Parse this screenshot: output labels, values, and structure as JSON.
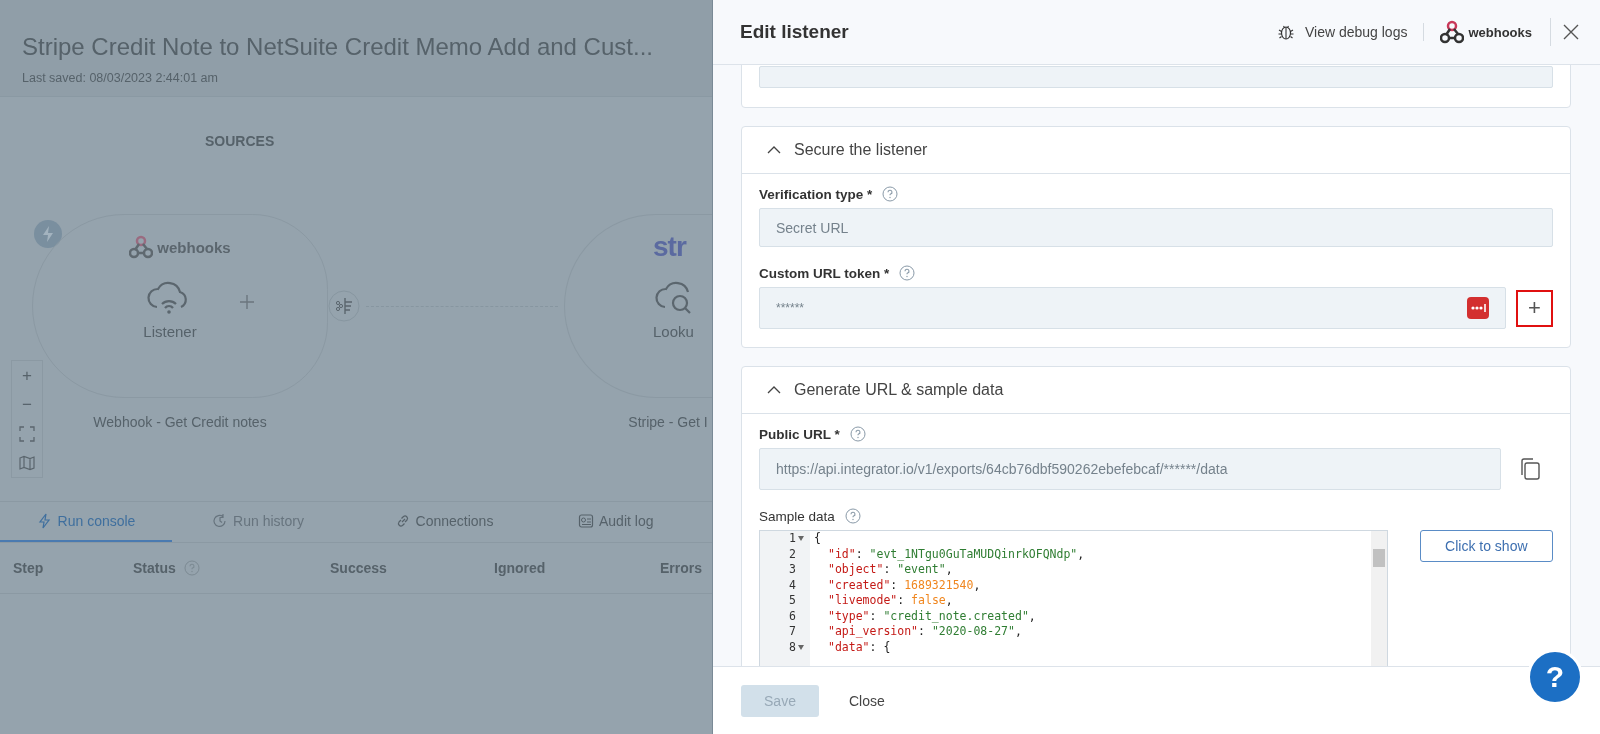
{
  "flow": {
    "title": "Stripe Credit Note to NetSuite Credit Memo Add and Cust...",
    "last_saved": "Last saved: 08/03/2023 2:44:01 am",
    "section_label": "SOURCES",
    "nodes": [
      {
        "logo_text": "webhooks",
        "step_label": "Listener",
        "caption": "Webhook - Get Credit notes",
        "kind": "listener"
      },
      {
        "logo_text": "str",
        "step_label": "Looku",
        "caption": "Stripe - Get I",
        "kind": "lookup"
      }
    ],
    "zoom_controls": [
      "+",
      "−"
    ]
  },
  "console": {
    "tabs": [
      {
        "label": "Run console",
        "selected": true,
        "disabled": false,
        "kind": "bolt"
      },
      {
        "label": "Run history",
        "selected": false,
        "disabled": true,
        "kind": "history"
      },
      {
        "label": "Connections",
        "selected": false,
        "disabled": false,
        "kind": "link"
      },
      {
        "label": "Audit log",
        "selected": false,
        "disabled": false,
        "kind": "audit"
      }
    ],
    "columns": [
      {
        "label": "Step",
        "help": false
      },
      {
        "label": "Status",
        "help": true
      },
      {
        "label": "Success",
        "help": false
      },
      {
        "label": "Ignored",
        "help": false
      },
      {
        "label": "Errors",
        "help": false
      }
    ]
  },
  "drawer": {
    "title": "Edit listener",
    "debug_link": "View debug logs",
    "app_logo": "webhooks",
    "sections": [
      {
        "title": "Secure the listener",
        "expanded": true,
        "fields": [
          {
            "kind": "text",
            "label": "Verification type *",
            "value": "Secret URL"
          },
          {
            "kind": "token",
            "label": "Custom URL token *",
            "value": "******",
            "add_highlighted": true,
            "add_symbol": "+"
          }
        ]
      },
      {
        "title": "Generate URL & sample data",
        "expanded": true,
        "fields": [
          {
            "kind": "url",
            "label": "Public URL *",
            "value": "https://api.integrator.io/v1/exports/64cb76dbf590262ebefebcaf/******/data"
          },
          {
            "kind": "code",
            "label": "Sample data",
            "button": "Click to show",
            "lines": [
              {
                "n": "1",
                "fold": true,
                "tokens": [
                  {
                    "t": "{",
                    "kind": "punct"
                  }
                ]
              },
              {
                "n": "2",
                "fold": false,
                "tokens": [
                  {
                    "t": "\"id\"",
                    "kind": "key"
                  },
                  {
                    "t": ": ",
                    "kind": "punct"
                  },
                  {
                    "t": "\"evt_1NTgu0GuTaMUDQinrkOFQNdp\"",
                    "kind": "str"
                  },
                  {
                    "t": ",",
                    "kind": "punct"
                  }
                ]
              },
              {
                "n": "3",
                "fold": false,
                "tokens": [
                  {
                    "t": "\"object\"",
                    "kind": "key"
                  },
                  {
                    "t": ": ",
                    "kind": "punct"
                  },
                  {
                    "t": "\"event\"",
                    "kind": "str"
                  },
                  {
                    "t": ",",
                    "kind": "punct"
                  }
                ]
              },
              {
                "n": "4",
                "fold": false,
                "tokens": [
                  {
                    "t": "\"created\"",
                    "kind": "key"
                  },
                  {
                    "t": ": ",
                    "kind": "punct"
                  },
                  {
                    "t": "1689321540",
                    "kind": "num"
                  },
                  {
                    "t": ",",
                    "kind": "punct"
                  }
                ]
              },
              {
                "n": "5",
                "fold": false,
                "tokens": [
                  {
                    "t": "\"livemode\"",
                    "kind": "key"
                  },
                  {
                    "t": ": ",
                    "kind": "punct"
                  },
                  {
                    "t": "false",
                    "kind": "num"
                  },
                  {
                    "t": ",",
                    "kind": "punct"
                  }
                ]
              },
              {
                "n": "6",
                "fold": false,
                "tokens": [
                  {
                    "t": "\"type\"",
                    "kind": "key"
                  },
                  {
                    "t": ": ",
                    "kind": "punct"
                  },
                  {
                    "t": "\"credit_note.created\"",
                    "kind": "str"
                  },
                  {
                    "t": ",",
                    "kind": "punct"
                  }
                ]
              },
              {
                "n": "7",
                "fold": false,
                "tokens": [
                  {
                    "t": "\"api_version\"",
                    "kind": "key"
                  },
                  {
                    "t": ": ",
                    "kind": "punct"
                  },
                  {
                    "t": "\"2020-08-27\"",
                    "kind": "str"
                  },
                  {
                    "t": ",",
                    "kind": "punct"
                  }
                ]
              },
              {
                "n": "8",
                "fold": true,
                "tokens": [
                  {
                    "t": "\"data\"",
                    "kind": "key"
                  },
                  {
                    "t": ": {",
                    "kind": "punct"
                  }
                ]
              }
            ]
          }
        ]
      }
    ],
    "footer": {
      "save": {
        "label": "Save",
        "disabled": true
      },
      "close": "Close"
    }
  },
  "help_button": "?"
}
